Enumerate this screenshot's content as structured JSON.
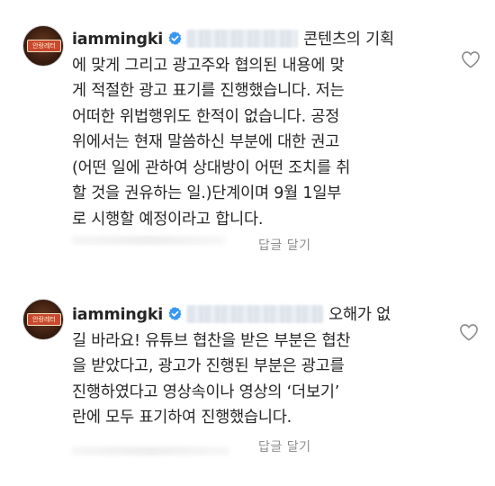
{
  "comments": [
    {
      "username": "iammingki",
      "avatar_sign": "안랑레터",
      "lines": [
        "콘텐츠의 기획",
        "에 맞게 그리고 광고주와 협의된 내용에 맞",
        "게 적절한 광고 표기를 진행했습니다. 저는",
        "어떠한 위법행위도 한적이 없습니다. 공정",
        "위에서는 현재 말씀하신 부분에 대한 권고",
        "(어떤 일에 관하여 상대방이 어떤 조치를 취",
        "할 것을 권유하는 일.)단계이며 9월 1일부",
        "로 시행할 예정이라고 합니다."
      ],
      "reply_label": "답글 달기"
    },
    {
      "username": "iammingki",
      "avatar_sign": "안랑레터",
      "lines": [
        "오해가 없",
        "길 바라요! 유튜브 협찬을 받은 부분은 협찬",
        "을 받았다고, 광고가 진행된 부분은 광고를",
        "진행하였다고 영상속이나 영상의 ‘더보기’",
        "란에 모두 표기하여 진행했습니다."
      ],
      "reply_label": "답글 달기"
    }
  ],
  "icons": {
    "verified_color": "#3897f0",
    "heart_color": "#8e8e8e"
  }
}
